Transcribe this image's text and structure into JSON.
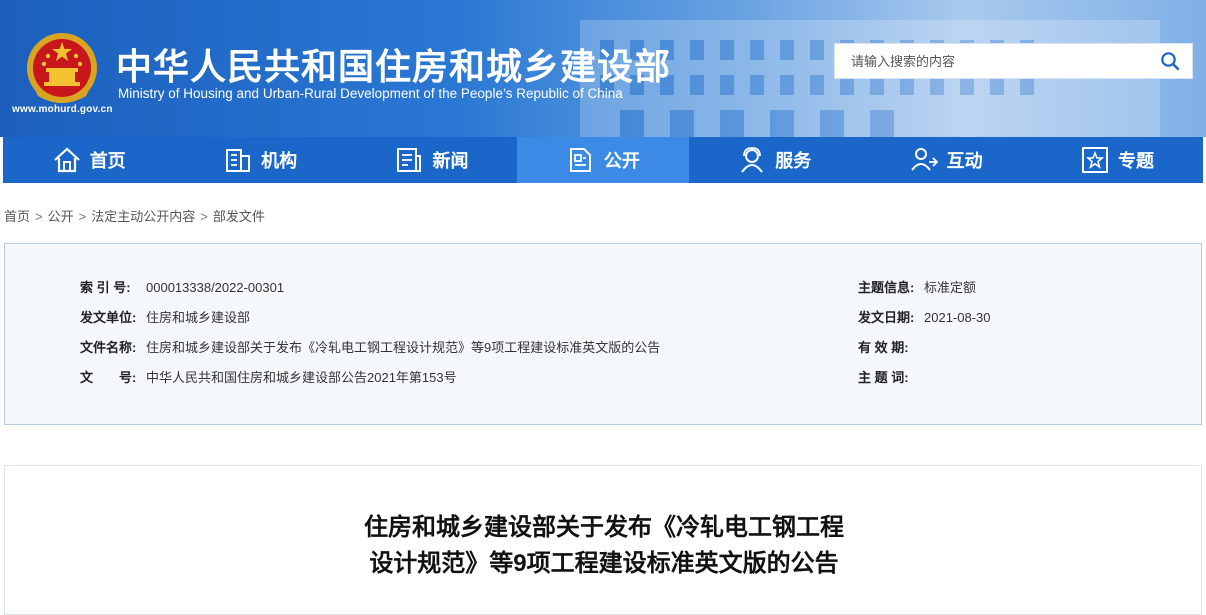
{
  "header": {
    "title_cn": "中华人民共和国住房和城乡建设部",
    "title_en": "Ministry of Housing and Urban-Rural Development of the People’s Republic of China",
    "site_url": "www.mohurd.gov.cn",
    "emblem_icon": "national-emblem-icon"
  },
  "search": {
    "placeholder": "请输入搜索的内容",
    "icon": "search-icon"
  },
  "nav": {
    "items": [
      {
        "label": "首页",
        "icon": "home-icon"
      },
      {
        "label": "机构",
        "icon": "building-icon"
      },
      {
        "label": "新闻",
        "icon": "news-icon"
      },
      {
        "label": "公开",
        "icon": "document-icon"
      },
      {
        "label": "服务",
        "icon": "service-icon"
      },
      {
        "label": "互动",
        "icon": "interaction-icon"
      },
      {
        "label": "专题",
        "icon": "star-icon"
      }
    ],
    "active": "公开"
  },
  "breadcrumb": {
    "items": [
      "首页",
      "公开",
      "法定主动公开内容",
      "部发文件"
    ],
    "separator": ">"
  },
  "info": {
    "index_label": "索 引 号:",
    "index_value": "000013338/2022-00301",
    "issuer_label": "发文单位:",
    "issuer_value": "住房和城乡建设部",
    "filename_label": "文件名称:",
    "filename_value": "住房和城乡建设部关于发布《冷轧电工钢工程设计规范》等9项工程建设标准英文版的公告",
    "docno_label": "文　　号:",
    "docno_value": "中华人民共和国住房和城乡建设部公告2021年第153号",
    "topic_label": "主题信息:",
    "topic_value": "标准定额",
    "date_label": "发文日期:",
    "date_value": "2021-08-30",
    "validity_label": "有 效 期:",
    "validity_value": "",
    "keywords_label": "主 题 词:",
    "keywords_value": ""
  },
  "article": {
    "title_line1": "住房和城乡建设部关于发布《冷轧电工钢工程",
    "title_line2": "设计规范》等9项工程建设标准英文版的公告"
  },
  "colors": {
    "nav_bg": "#1b66c9",
    "nav_active": "#3a8ae6",
    "header_blue": "#2a78d4",
    "info_bg": "#f4f8fc",
    "info_border": "#b9cbe1"
  }
}
